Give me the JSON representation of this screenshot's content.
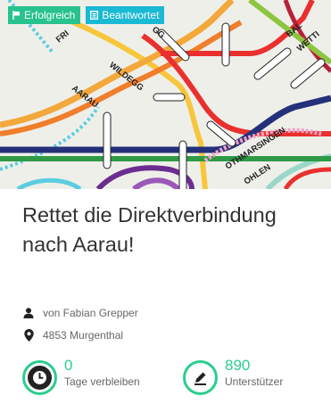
{
  "badges": {
    "success": "Erfolgreich",
    "answered": "Beantwortet"
  },
  "map_labels": {
    "top_left": "FRI",
    "wildegg": "WILDEGG",
    "aarau": "AARAU",
    "top_mid": "GG",
    "bal": "BAL",
    "wetti": "WETTI",
    "othmarsingen": "OTHMARSINGEN",
    "lenzburg": "OHLEN"
  },
  "petition": {
    "title": "Rettet die Direktverbindung nach Aarau!",
    "author": "von Fabian Grepper",
    "location": "4853 Murgenthal"
  },
  "stats": {
    "days_value": "0",
    "days_label": "Tage verbleiben",
    "supporters_value": "890",
    "supporters_label": "Unterstützer"
  },
  "colors": {
    "accent_green": "#2bcd8e",
    "badge_success": "#27c28d",
    "badge_answered": "#1ab9d4"
  },
  "icons": {
    "success_badge": "flag-icon",
    "answered_badge": "document-icon",
    "author": "person-icon",
    "location": "map-pin-icon",
    "days": "clock-icon",
    "supporters": "pencil-icon"
  }
}
